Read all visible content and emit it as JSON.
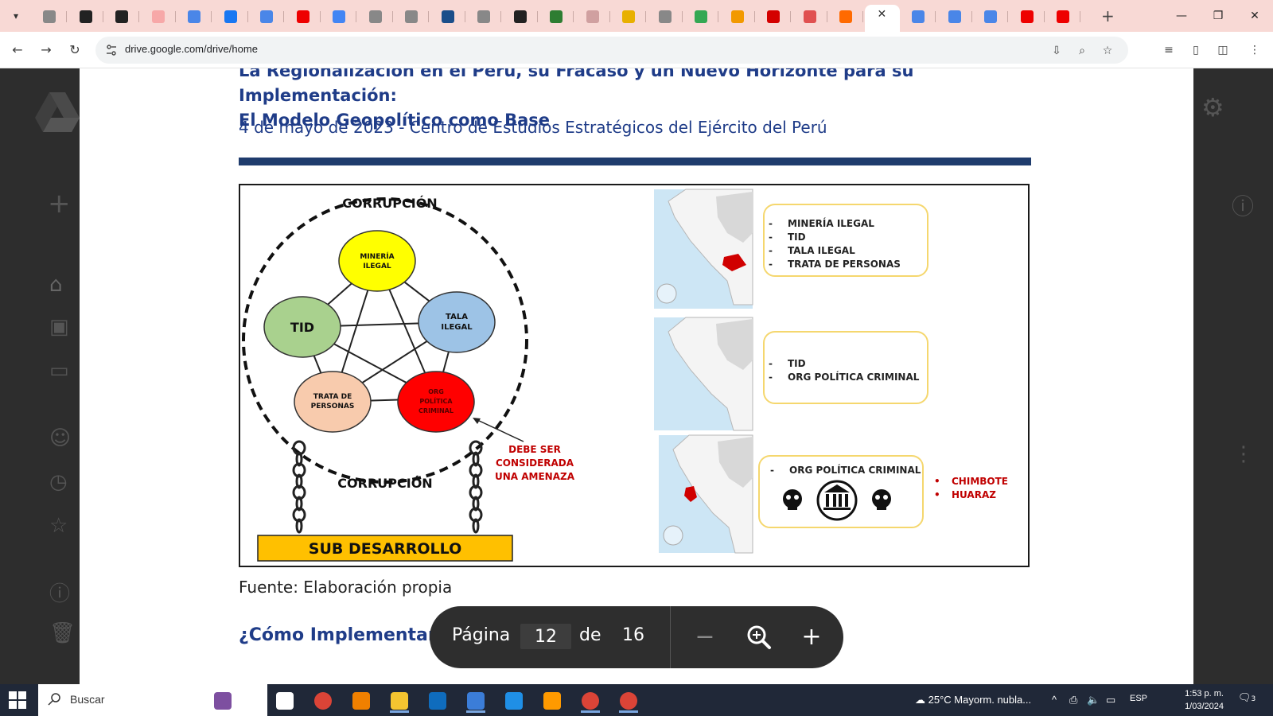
{
  "browser": {
    "url": "drive.google.com/drive/home",
    "tab_count": 29
  },
  "document": {
    "title_line1": "La Regionalización en el Perú, su Fracaso y un Nuevo Horizonte para su Implementación:",
    "title_line2": "El Modelo Geopolítico como Base",
    "subtitle": "4 de mayo de 2023 - Centro de Estudios Estratégicos del Ejército del Perú",
    "figure": {
      "corruption_top": "CORRUPCIÓN",
      "corruption_bottom": "CORRUPCIÓN",
      "nodes": {
        "mineria": [
          "MINERÍA",
          "ILEGAL"
        ],
        "tala": [
          "TALA",
          "ILEGAL"
        ],
        "tid": "TID",
        "trata": [
          "TRATA DE",
          "PERSONAS"
        ],
        "org": [
          "ORG",
          "POLÍTICA",
          "CRIMINAL"
        ]
      },
      "threat_note": [
        "DEBE SER",
        "CONSIDERADA",
        "UNA AMENAZA"
      ],
      "base_label": "SUB DESARROLLO",
      "box1": [
        "MINERÍA ILEGAL",
        "TID",
        "TALA ILEGAL",
        "TRATA DE PERSONAS"
      ],
      "box2": [
        "TID",
        "ORG POLÍTICA CRIMINAL"
      ],
      "box3": [
        "ORG POLÍTICA CRIMINAL"
      ],
      "cities": [
        "CHIMBOTE",
        "HUARAZ"
      ],
      "colors": {
        "mineria": "#ffff00",
        "tala": "#9dc3e6",
        "tid": "#a9d18e",
        "trata": "#f8cbad",
        "org": "#ff0000",
        "base": "#ffc000",
        "box_border": "#f5d76e",
        "threat_text": "#c00000"
      }
    },
    "source": "Fuente: Elaboración propia",
    "next_heading": "¿Cómo Implementar la Regionalización?"
  },
  "pager": {
    "page_label": "Página",
    "current_page": "12",
    "of_label": "de",
    "total_pages": "16"
  },
  "taskbar": {
    "search_placeholder": "Buscar",
    "weather": "25°C  Mayorm. nubla...",
    "language": "ESP",
    "time": "1:53 p. m.",
    "date": "1/03/2024",
    "notifications": "3"
  }
}
